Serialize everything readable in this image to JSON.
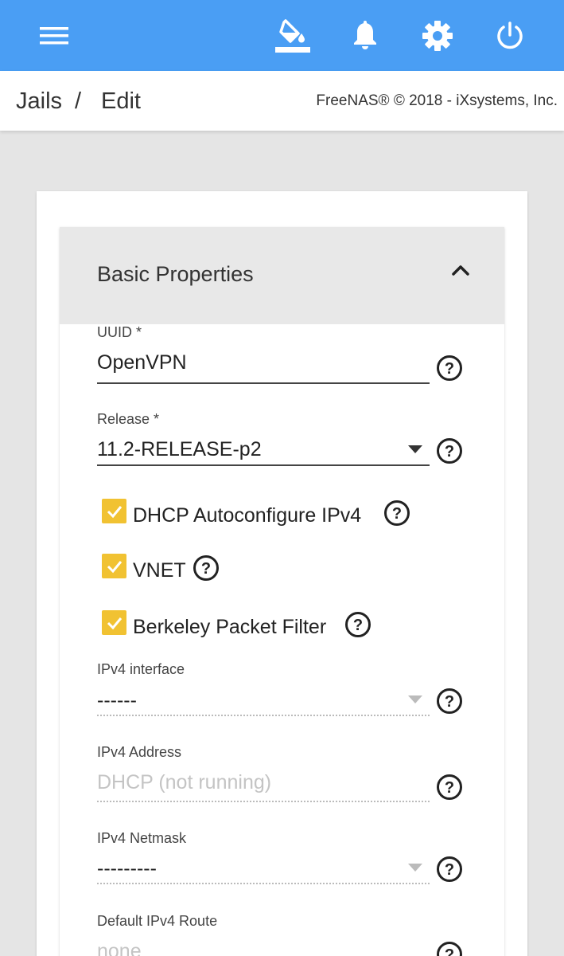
{
  "topbar": {
    "bg_color": "#4a9ef4",
    "icons": [
      "menu-icon",
      "paint-bucket-icon",
      "bell-icon",
      "gear-icon",
      "power-icon"
    ]
  },
  "breadcrumb": {
    "root": "Jails",
    "separator": "/",
    "current": "Edit",
    "copyright": "FreeNAS® © 2018 - iXsystems, Inc."
  },
  "panel": {
    "title": "Basic Properties"
  },
  "fields": {
    "uuid": {
      "label": "UUID *",
      "value": "OpenVPN"
    },
    "release": {
      "label": "Release *",
      "value": "11.2-RELEASE-p2"
    },
    "dhcp": {
      "label": "DHCP Autoconfigure IPv4",
      "checked": true
    },
    "vnet": {
      "label": "VNET",
      "checked": true
    },
    "bpf": {
      "label": "Berkeley Packet Filter",
      "checked": true
    },
    "ipv4_interface": {
      "label": "IPv4 interface",
      "value": "------"
    },
    "ipv4_address": {
      "label": "IPv4 Address",
      "placeholder": "DHCP (not running)"
    },
    "ipv4_netmask": {
      "label": "IPv4 Netmask",
      "value": "---------"
    },
    "default_route": {
      "label": "Default IPv4 Route",
      "placeholder": "none"
    }
  },
  "colors": {
    "checkbox": "#f1c232",
    "accent": "#4a9ef4"
  }
}
